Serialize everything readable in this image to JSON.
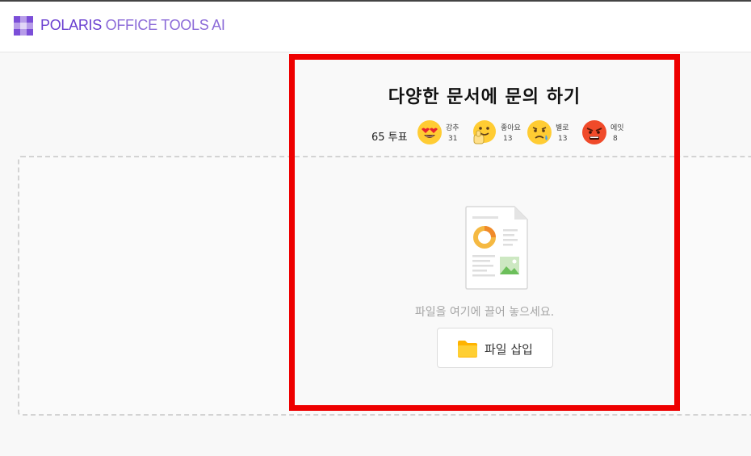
{
  "header": {
    "brand_part1": "POLARIS",
    "brand_part2": " OFFICE TOOLS AI",
    "logo_icon": "polaris-grid-logo"
  },
  "panel": {
    "title": "다양한 문서에 문의 하기",
    "vote_total": "65 투표",
    "reactions": [
      {
        "label": "강추",
        "count": "31",
        "icon": "heart-eyes-emoji"
      },
      {
        "label": "좋아요",
        "count": "13",
        "icon": "thumbs-up-emoji"
      },
      {
        "label": "별로",
        "count": "13",
        "icon": "sad-emoji"
      },
      {
        "label": "에잇",
        "count": "8",
        "icon": "angry-emoji"
      }
    ],
    "drop_text": "파일을 여기에 끌어 놓으세요.",
    "insert_button_label": "파일 삽입"
  },
  "colors": {
    "brand": "#6a3fd0",
    "highlight_border": "#ee0000",
    "folder": "#ffc107"
  }
}
